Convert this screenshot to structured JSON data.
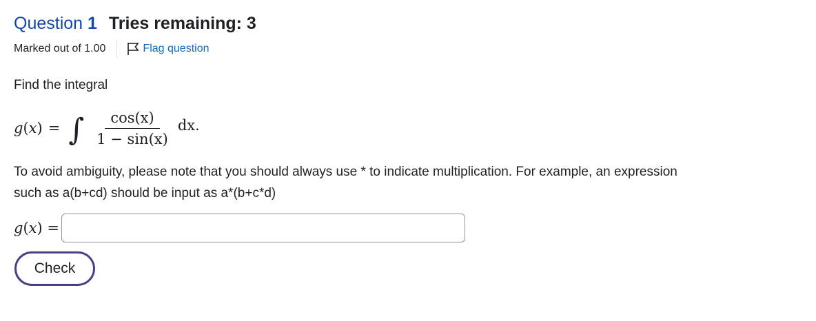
{
  "question": {
    "word": "Question",
    "number": "1",
    "tries": "Tries remaining: 3",
    "marked": "Marked out of 1.00",
    "flag_label": "Flag question"
  },
  "prompt": "Find the integral",
  "formula": {
    "lhs_fn": "g",
    "lhs_var": "x",
    "numerator": "cos(x)",
    "denominator": "1 − sin(x)",
    "differential": "dx."
  },
  "note": "To avoid ambiguity, please note that you should always use * to indicate multiplication. For example, an expression such as a(b+cd) should be input as a*(b+c*d)",
  "answer": {
    "label_fn": "g",
    "label_var": "x",
    "value": "",
    "placeholder": ""
  },
  "check_label": "Check",
  "colors": {
    "link": "#0f6cbf",
    "question_number": "#0f47ad",
    "button_border": "#4a3f86"
  },
  "icons": [
    "flag-icon"
  ]
}
